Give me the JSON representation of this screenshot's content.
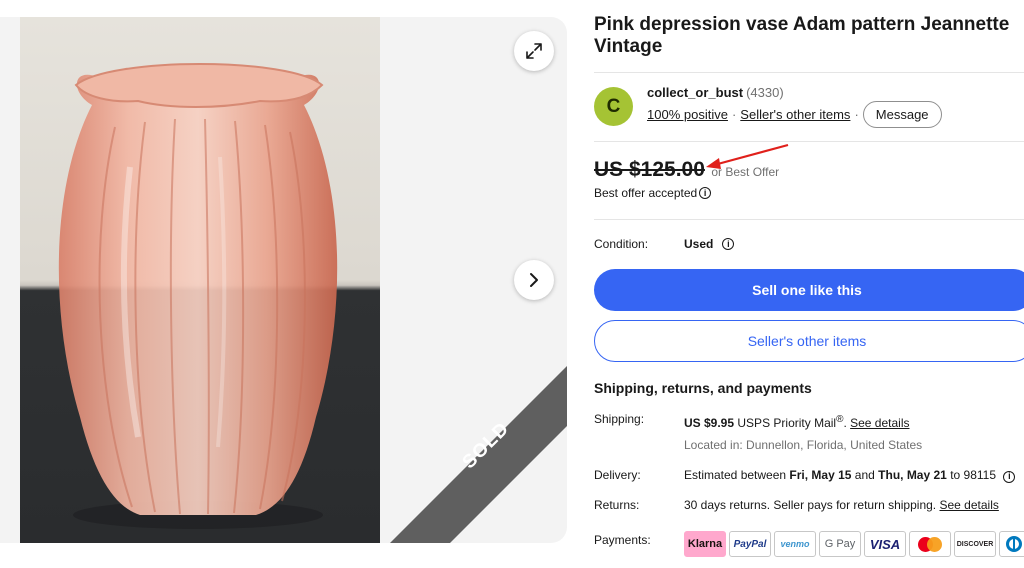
{
  "listing": {
    "title": "Pink depression vase Adam pattern Jeannette Vintage",
    "status_ribbon": "SOLD"
  },
  "seller": {
    "avatar_letter": "C",
    "name": "collect_or_bust",
    "feedback_count": "(4330)",
    "positive": "100% positive",
    "other_items": "Seller's other items",
    "message_label": "Message",
    "separator": "·"
  },
  "price": {
    "amount": "US $125.00",
    "best_offer": "or Best Offer",
    "offer_accepted": "Best offer accepted",
    "info_glyph": "i"
  },
  "condition": {
    "label": "Condition:",
    "value": "Used"
  },
  "buttons": {
    "sell_one": "Sell one like this",
    "sellers_other_items": "Seller's other items"
  },
  "shipping_section": {
    "heading": "Shipping, returns, and payments",
    "shipping_label": "Shipping:",
    "shipping_cost": "US $9.95",
    "shipping_method": "USPS Priority Mail",
    "shipping_reg": "®",
    "shipping_details": "See details",
    "located_in": "Located in: Dunnellon, Florida, United States",
    "delivery_label": "Delivery:",
    "delivery_prefix": "Estimated between",
    "delivery_start": "Fri, May 15",
    "delivery_and": "and",
    "delivery_end": "Thu, May 21",
    "delivery_to": "to 98115",
    "returns_label": "Returns:",
    "returns_text": "30 days returns. Seller pays for return shipping.",
    "returns_details": "See details",
    "payments_label": "Payments:"
  },
  "payment_methods": [
    "Klarna",
    "PayPal",
    "venmo",
    "G Pay",
    "VISA",
    "DISCOVER"
  ],
  "colors": {
    "primary_blue": "#3665f3",
    "avatar_green": "#a5c334",
    "ribbon_gray": "#5f5f5f",
    "annotation_red": "#e0201b"
  },
  "icons": [
    "expand-icon",
    "chevron-right-icon",
    "info-icon",
    "annotation-arrow"
  ]
}
